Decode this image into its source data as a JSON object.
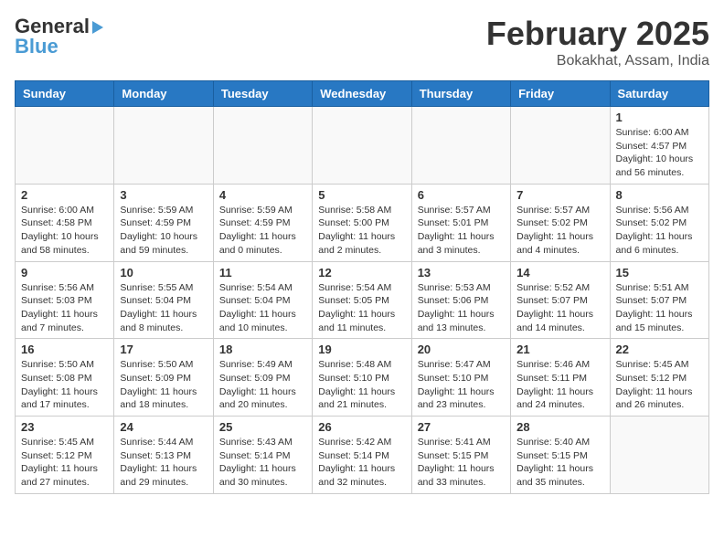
{
  "header": {
    "logo_general": "General",
    "logo_blue": "Blue",
    "month": "February 2025",
    "location": "Bokakhat, Assam, India"
  },
  "weekdays": [
    "Sunday",
    "Monday",
    "Tuesday",
    "Wednesday",
    "Thursday",
    "Friday",
    "Saturday"
  ],
  "weeks": [
    [
      {
        "day": "",
        "info": ""
      },
      {
        "day": "",
        "info": ""
      },
      {
        "day": "",
        "info": ""
      },
      {
        "day": "",
        "info": ""
      },
      {
        "day": "",
        "info": ""
      },
      {
        "day": "",
        "info": ""
      },
      {
        "day": "1",
        "info": "Sunrise: 6:00 AM\nSunset: 4:57 PM\nDaylight: 10 hours\nand 56 minutes."
      }
    ],
    [
      {
        "day": "2",
        "info": "Sunrise: 6:00 AM\nSunset: 4:58 PM\nDaylight: 10 hours\nand 58 minutes."
      },
      {
        "day": "3",
        "info": "Sunrise: 5:59 AM\nSunset: 4:59 PM\nDaylight: 10 hours\nand 59 minutes."
      },
      {
        "day": "4",
        "info": "Sunrise: 5:59 AM\nSunset: 4:59 PM\nDaylight: 11 hours\nand 0 minutes."
      },
      {
        "day": "5",
        "info": "Sunrise: 5:58 AM\nSunset: 5:00 PM\nDaylight: 11 hours\nand 2 minutes."
      },
      {
        "day": "6",
        "info": "Sunrise: 5:57 AM\nSunset: 5:01 PM\nDaylight: 11 hours\nand 3 minutes."
      },
      {
        "day": "7",
        "info": "Sunrise: 5:57 AM\nSunset: 5:02 PM\nDaylight: 11 hours\nand 4 minutes."
      },
      {
        "day": "8",
        "info": "Sunrise: 5:56 AM\nSunset: 5:02 PM\nDaylight: 11 hours\nand 6 minutes."
      }
    ],
    [
      {
        "day": "9",
        "info": "Sunrise: 5:56 AM\nSunset: 5:03 PM\nDaylight: 11 hours\nand 7 minutes."
      },
      {
        "day": "10",
        "info": "Sunrise: 5:55 AM\nSunset: 5:04 PM\nDaylight: 11 hours\nand 8 minutes."
      },
      {
        "day": "11",
        "info": "Sunrise: 5:54 AM\nSunset: 5:04 PM\nDaylight: 11 hours\nand 10 minutes."
      },
      {
        "day": "12",
        "info": "Sunrise: 5:54 AM\nSunset: 5:05 PM\nDaylight: 11 hours\nand 11 minutes."
      },
      {
        "day": "13",
        "info": "Sunrise: 5:53 AM\nSunset: 5:06 PM\nDaylight: 11 hours\nand 13 minutes."
      },
      {
        "day": "14",
        "info": "Sunrise: 5:52 AM\nSunset: 5:07 PM\nDaylight: 11 hours\nand 14 minutes."
      },
      {
        "day": "15",
        "info": "Sunrise: 5:51 AM\nSunset: 5:07 PM\nDaylight: 11 hours\nand 15 minutes."
      }
    ],
    [
      {
        "day": "16",
        "info": "Sunrise: 5:50 AM\nSunset: 5:08 PM\nDaylight: 11 hours\nand 17 minutes."
      },
      {
        "day": "17",
        "info": "Sunrise: 5:50 AM\nSunset: 5:09 PM\nDaylight: 11 hours\nand 18 minutes."
      },
      {
        "day": "18",
        "info": "Sunrise: 5:49 AM\nSunset: 5:09 PM\nDaylight: 11 hours\nand 20 minutes."
      },
      {
        "day": "19",
        "info": "Sunrise: 5:48 AM\nSunset: 5:10 PM\nDaylight: 11 hours\nand 21 minutes."
      },
      {
        "day": "20",
        "info": "Sunrise: 5:47 AM\nSunset: 5:10 PM\nDaylight: 11 hours\nand 23 minutes."
      },
      {
        "day": "21",
        "info": "Sunrise: 5:46 AM\nSunset: 5:11 PM\nDaylight: 11 hours\nand 24 minutes."
      },
      {
        "day": "22",
        "info": "Sunrise: 5:45 AM\nSunset: 5:12 PM\nDaylight: 11 hours\nand 26 minutes."
      }
    ],
    [
      {
        "day": "23",
        "info": "Sunrise: 5:45 AM\nSunset: 5:12 PM\nDaylight: 11 hours\nand 27 minutes."
      },
      {
        "day": "24",
        "info": "Sunrise: 5:44 AM\nSunset: 5:13 PM\nDaylight: 11 hours\nand 29 minutes."
      },
      {
        "day": "25",
        "info": "Sunrise: 5:43 AM\nSunset: 5:14 PM\nDaylight: 11 hours\nand 30 minutes."
      },
      {
        "day": "26",
        "info": "Sunrise: 5:42 AM\nSunset: 5:14 PM\nDaylight: 11 hours\nand 32 minutes."
      },
      {
        "day": "27",
        "info": "Sunrise: 5:41 AM\nSunset: 5:15 PM\nDaylight: 11 hours\nand 33 minutes."
      },
      {
        "day": "28",
        "info": "Sunrise: 5:40 AM\nSunset: 5:15 PM\nDaylight: 11 hours\nand 35 minutes."
      },
      {
        "day": "",
        "info": ""
      }
    ]
  ]
}
